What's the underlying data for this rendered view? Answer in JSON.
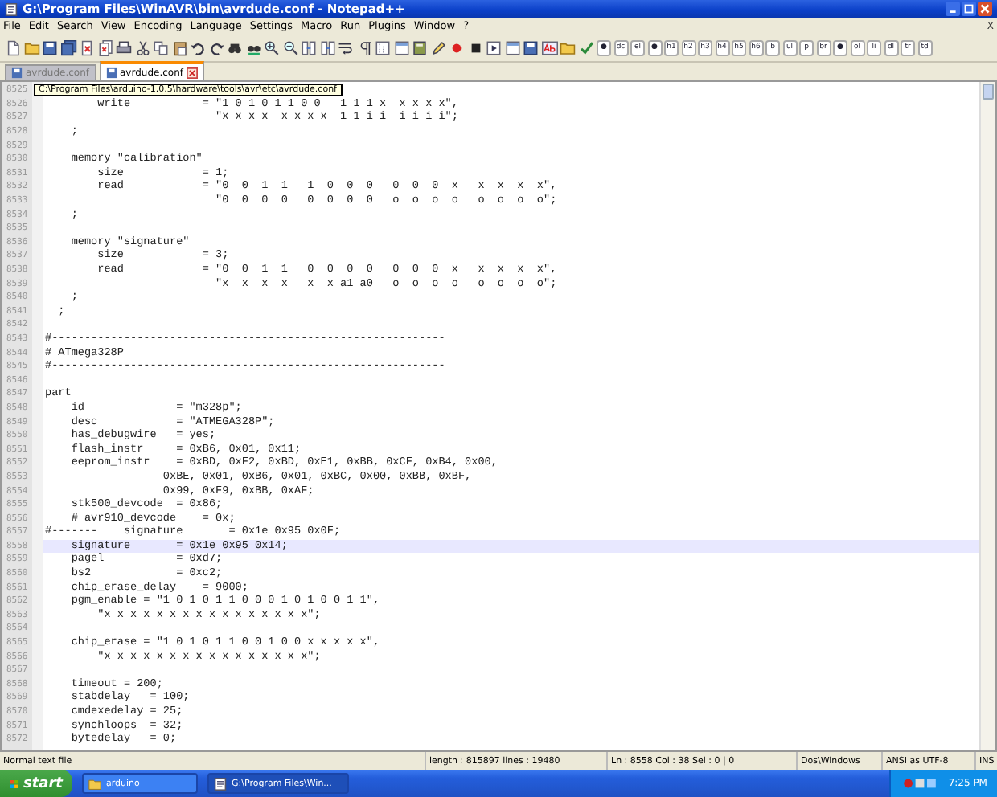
{
  "window": {
    "title": "G:\\Program Files\\WinAVR\\bin\\avrdude.conf - Notepad++"
  },
  "menu": [
    "File",
    "Edit",
    "Search",
    "View",
    "Encoding",
    "Language",
    "Settings",
    "Macro",
    "Run",
    "Plugins",
    "Window",
    "?"
  ],
  "menu_close": "X",
  "toolbar": [
    {
      "kind": "new"
    },
    {
      "kind": "open"
    },
    {
      "kind": "save"
    },
    {
      "kind": "saveall"
    },
    {
      "kind": "close"
    },
    {
      "kind": "closeall"
    },
    {
      "kind": "print"
    },
    {
      "kind": "cut"
    },
    {
      "kind": "copy"
    },
    {
      "kind": "paste"
    },
    {
      "kind": "undo"
    },
    {
      "kind": "redo"
    },
    {
      "kind": "find"
    },
    {
      "kind": "replace"
    },
    {
      "kind": "zoomin"
    },
    {
      "kind": "zoomout"
    },
    {
      "kind": "sync"
    },
    {
      "kind": "sync"
    },
    {
      "kind": "wrap"
    },
    {
      "kind": "pilcrow"
    },
    {
      "kind": "indent"
    },
    {
      "kind": "panel"
    },
    {
      "kind": "book"
    },
    {
      "kind": "pencil"
    },
    {
      "kind": "record"
    },
    {
      "kind": "stop"
    },
    {
      "kind": "play"
    },
    {
      "kind": "panel"
    },
    {
      "kind": "save"
    },
    {
      "kind": "spell"
    },
    {
      "kind": "open"
    },
    {
      "kind": "check"
    }
  ],
  "tag_buttons": [
    "●",
    "dc",
    "el",
    "●",
    "h1",
    "h2",
    "h3",
    "h4",
    "h5",
    "h6",
    "b",
    "ul",
    "p",
    "br",
    "●",
    "ol",
    "li",
    "dl",
    "tr",
    "td"
  ],
  "tabs": [
    {
      "label": "avrdude.conf",
      "selected": false
    },
    {
      "label": "avrdude.conf",
      "selected": true
    }
  ],
  "tooltip": "C:\\Program Files\\arduino-1.0.5\\hardware\\tools\\avr\\etc\\avrdude.conf",
  "lines": [
    {
      "number": "8525",
      "current": false
    },
    {
      "number": "8526",
      "text": "        write           = \"1 0 1 0 1 1 0 0   1 1 1 x  x x x x\",",
      "current": false
    },
    {
      "number": "8527",
      "text": "                          \"x x x x  x x x x  1 1 i i  i i i i\";",
      "current": false
    },
    {
      "number": "8528",
      "text": "    ;",
      "current": false
    },
    {
      "number": "8529",
      "current": false
    },
    {
      "number": "8530",
      "text": "    memory \"calibration\"",
      "current": false
    },
    {
      "number": "8531",
      "text": "        size            = 1;",
      "current": false
    },
    {
      "number": "8532",
      "text": "        read            = \"0  0  1  1   1  0  0  0   0  0  0  x   x  x  x  x\",",
      "current": false
    },
    {
      "number": "8533",
      "text": "                          \"0  0  0  0   0  0  0  0   o  o  o  o   o  o  o  o\";",
      "current": false
    },
    {
      "number": "8534",
      "text": "    ;",
      "current": false
    },
    {
      "number": "8535",
      "current": false
    },
    {
      "number": "8536",
      "text": "    memory \"signature\"",
      "current": false
    },
    {
      "number": "8537",
      "text": "        size            = 3;",
      "current": false
    },
    {
      "number": "8538",
      "text": "        read            = \"0  0  1  1   0  0  0  0   0  0  0  x   x  x  x  x\",",
      "current": false
    },
    {
      "number": "8539",
      "text": "                          \"x  x  x  x   x  x a1 a0   o  o  o  o   o  o  o  o\";",
      "current": false
    },
    {
      "number": "8540",
      "text": "    ;",
      "current": false
    },
    {
      "number": "8541",
      "text": "  ;",
      "current": false
    },
    {
      "number": "8542",
      "current": false
    },
    {
      "number": "8543",
      "text": "#------------------------------------------------------------",
      "current": false
    },
    {
      "number": "8544",
      "text": "# ATmega328P",
      "current": false
    },
    {
      "number": "8545",
      "text": "#------------------------------------------------------------",
      "current": false
    },
    {
      "number": "8546",
      "current": false
    },
    {
      "number": "8547",
      "text": "part",
      "current": false
    },
    {
      "number": "8548",
      "text": "    id              = \"m328p\";",
      "current": false
    },
    {
      "number": "8549",
      "text": "    desc            = \"ATMEGA328P\";",
      "current": false
    },
    {
      "number": "8550",
      "text": "    has_debugwire   = yes;",
      "current": false
    },
    {
      "number": "8551",
      "text": "    flash_instr     = 0xB6, 0x01, 0x11;",
      "current": false
    },
    {
      "number": "8552",
      "text": "    eeprom_instr    = 0xBD, 0xF2, 0xBD, 0xE1, 0xBB, 0xCF, 0xB4, 0x00,",
      "current": false
    },
    {
      "number": "8553",
      "text": "                  0xBE, 0x01, 0xB6, 0x01, 0xBC, 0x00, 0xBB, 0xBF,",
      "current": false
    },
    {
      "number": "8554",
      "text": "                  0x99, 0xF9, 0xBB, 0xAF;",
      "current": false
    },
    {
      "number": "8555",
      "text": "    stk500_devcode  = 0x86;",
      "current": false
    },
    {
      "number": "8556",
      "text": "    # avr910_devcode    = 0x;",
      "current": false
    },
    {
      "number": "8557",
      "text": "#-------    signature       = 0x1e 0x95 0x0F;",
      "current": false
    },
    {
      "number": "8558",
      "text": "    signature       = 0x1e 0x95 0x14;",
      "current": true
    },
    {
      "number": "8559",
      "text": "    pagel           = 0xd7;",
      "current": false
    },
    {
      "number": "8560",
      "text": "    bs2             = 0xc2;",
      "current": false
    },
    {
      "number": "8561",
      "text": "    chip_erase_delay    = 9000;",
      "current": false
    },
    {
      "number": "8562",
      "text": "    pgm_enable = \"1 0 1 0 1 1 0 0 0 1 0 1 0 0 1 1\",",
      "current": false
    },
    {
      "number": "8563",
      "text": "        \"x x x x x x x x x x x x x x x x\";",
      "current": false
    },
    {
      "number": "8564",
      "current": false
    },
    {
      "number": "8565",
      "text": "    chip_erase = \"1 0 1 0 1 1 0 0 1 0 0 x x x x x\",",
      "current": false
    },
    {
      "number": "8566",
      "text": "        \"x x x x x x x x x x x x x x x x\";",
      "current": false
    },
    {
      "number": "8567",
      "current": false
    },
    {
      "number": "8568",
      "text": "    timeout = 200;",
      "current": false
    },
    {
      "number": "8569",
      "text": "    stabdelay   = 100;",
      "current": false
    },
    {
      "number": "8570",
      "text": "    cmdexedelay = 25;",
      "current": false
    },
    {
      "number": "8571",
      "text": "    synchloops  = 32;",
      "current": false
    },
    {
      "number": "8572",
      "text": "    bytedelay   = 0;",
      "current": false
    }
  ],
  "status_bar": {
    "file_type": "Normal text file",
    "length": "length : 815897    lines : 19480",
    "position": "Ln : 8558    Col : 38    Sel : 0 | 0",
    "line_endings": "Dos\\Windows",
    "encoding": "ANSI as UTF-8",
    "mode": "INS"
  },
  "taskbar": {
    "start": "start",
    "windows": [
      {
        "label": "arduino",
        "selected": false
      },
      {
        "label": "G:\\Program Files\\Win...",
        "selected": true
      }
    ],
    "clock": "7:25 PM"
  }
}
